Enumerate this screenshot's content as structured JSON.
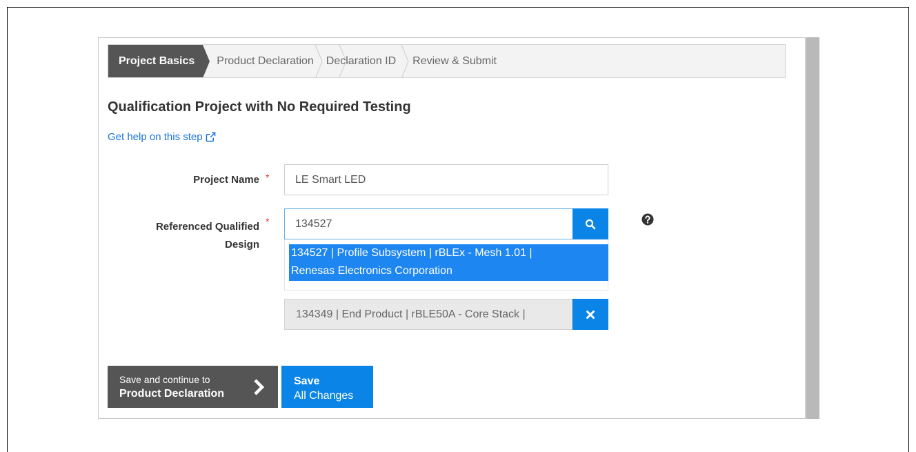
{
  "wizard": {
    "steps": [
      {
        "label": "Project Basics",
        "active": true
      },
      {
        "label": "Product Declaration",
        "active": false
      },
      {
        "label": "Declaration ID",
        "active": false
      },
      {
        "label": "Review & Submit",
        "active": false
      }
    ]
  },
  "page": {
    "title": "Qualification Project with No Required Testing",
    "help_link": "Get help on this step"
  },
  "form": {
    "project_name": {
      "label": "Project Name",
      "required_mark": "*",
      "value": "LE Smart LED"
    },
    "referenced_design": {
      "label_line1": "Referenced Qualified",
      "label_line2": "Design",
      "required_mark": "*",
      "search_value": "134527",
      "suggestion_line1": "134527 | Profile Subsystem | rBLEx - Mesh 1.01 |",
      "suggestion_line2": "Renesas Electronics Corporation",
      "selected_tag": "134349 | End Product | rBLE50A - Core Stack |"
    }
  },
  "actions": {
    "continue_line1": "Save and continue to",
    "continue_line2": "Product Declaration",
    "save_line1": "Save",
    "save_line2": "All Changes"
  },
  "colors": {
    "accent": "#0a84e6",
    "active_step": "#555555",
    "required": "#d9342b",
    "link": "#1a73d9"
  },
  "icons": {
    "help_link": "external-link-icon",
    "search": "search-icon",
    "remove": "close-icon",
    "info": "question-circle-icon",
    "continue": "chevron-right-icon"
  }
}
